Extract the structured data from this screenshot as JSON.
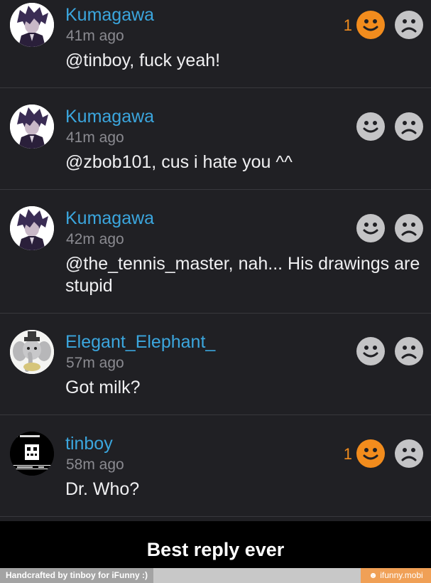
{
  "comments": [
    {
      "username": "Kumagawa",
      "time": "41m ago",
      "text": "@tinboy, fuck yeah!",
      "vote_count": "1",
      "upvoted": true,
      "avatar_icon": "anime-boy-avatar-icon"
    },
    {
      "username": "Kumagawa",
      "time": "41m ago",
      "text": "@zbob101, cus i hate you ^^",
      "vote_count": "",
      "upvoted": false,
      "avatar_icon": "anime-boy-avatar-icon"
    },
    {
      "username": "Kumagawa",
      "time": "42m ago",
      "text": "@the_tennis_master, nah... His drawings are stupid",
      "vote_count": "",
      "upvoted": false,
      "avatar_icon": "anime-boy-avatar-icon"
    },
    {
      "username": "Elegant_Elephant_",
      "time": "57m ago",
      "text": "Got milk?",
      "vote_count": "",
      "upvoted": false,
      "avatar_icon": "elephant-avatar-icon"
    },
    {
      "username": "tinboy",
      "time": "58m ago",
      "text": "Dr. Who?",
      "vote_count": "1",
      "upvoted": true,
      "avatar_icon": "pixel-skull-avatar-icon"
    }
  ],
  "caption": "Best reply ever",
  "footer": {
    "left_text": "Handcrafted by tinboy for iFunny :)",
    "right_text": "☻ ifunny.mobi"
  },
  "colors": {
    "background": "#202024",
    "username": "#3ba6de",
    "accent_orange": "#f28c1d",
    "icon_gray": "#c4c4c6"
  }
}
